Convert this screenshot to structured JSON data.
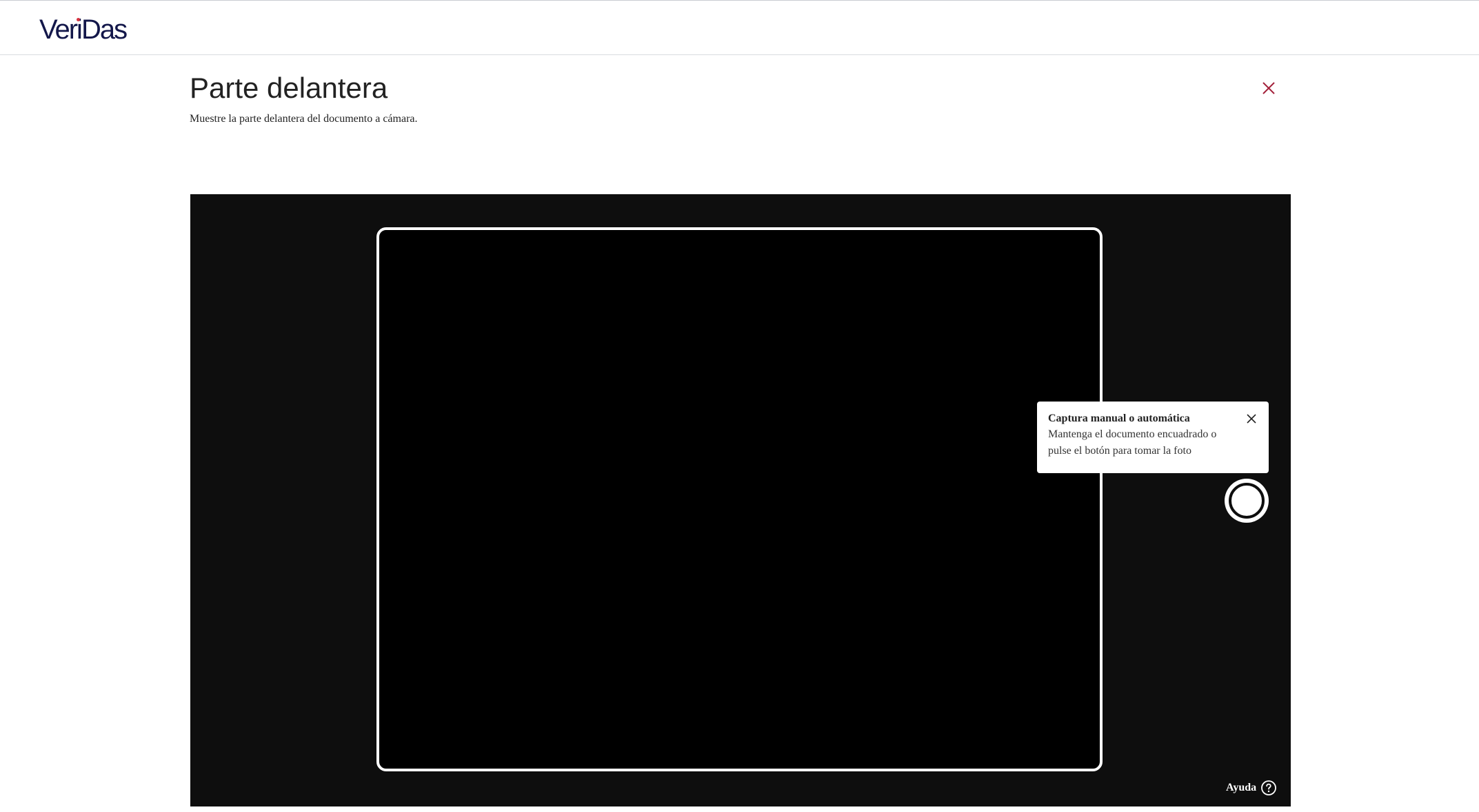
{
  "header": {
    "logo": {
      "text_before": "Ver",
      "text_i": "i",
      "text_after": "Das",
      "dot_color": "#d9323f",
      "color": "#13174a"
    }
  },
  "main": {
    "title": "Parte delantera",
    "subtitle": "Muestre la parte delantera del documento a cámara.",
    "close_icon": "close-icon",
    "close_color": "#a3203a"
  },
  "camera": {
    "tooltip": {
      "title": "Captura manual o automática",
      "body": "Mantenga el documento encuadrado o pulse el botón para tomar la foto",
      "close_icon": "close-icon"
    },
    "shutter_icon": "shutter-button",
    "help": {
      "label": "Ayuda",
      "icon": "question-circle-icon"
    }
  }
}
